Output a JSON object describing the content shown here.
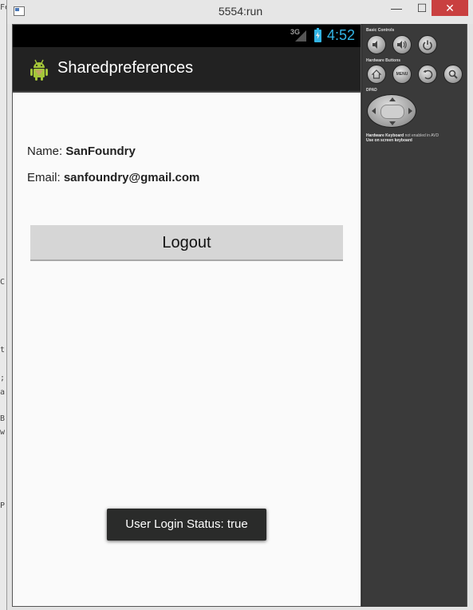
{
  "window": {
    "title": "5554:run",
    "minimize_glyph": "—",
    "maximize_glyph": "☐",
    "close_glyph": "✕"
  },
  "background_glyphs": [
    "Fe",
    "C",
    "t",
    ";",
    "a",
    "B",
    "w",
    "P"
  ],
  "status_bar": {
    "network": "3G",
    "time": "4:52"
  },
  "action_bar": {
    "app_title": "Sharedpreferences"
  },
  "profile": {
    "name_label": "Name: ",
    "name_value": "SanFoundry",
    "email_label": "Email: ",
    "email_value": "sanfoundry@gmail.com"
  },
  "logout_button": {
    "label": "Logout"
  },
  "toast": {
    "message": "User Login Status: true"
  },
  "emulator_controls": {
    "basic_controls_heading": "Basic Controls",
    "hardware_buttons_heading": "Hardware Buttons",
    "dpad_heading": "DPAD",
    "menu_label": "MENU",
    "keyboard_note_bold": "Hardware Keyboard",
    "keyboard_note_rest": " not enabled in AVD",
    "keyboard_note_line2": "Use on screen keyboard"
  },
  "colors": {
    "accent_blue": "#33b5e5",
    "action_bar": "#222222",
    "status_bar": "#000000",
    "button_gray": "#d6d6d6",
    "toast_bg": "#2a2b2a",
    "close_red": "#c94040",
    "panel_bg": "#3a3a3a"
  }
}
